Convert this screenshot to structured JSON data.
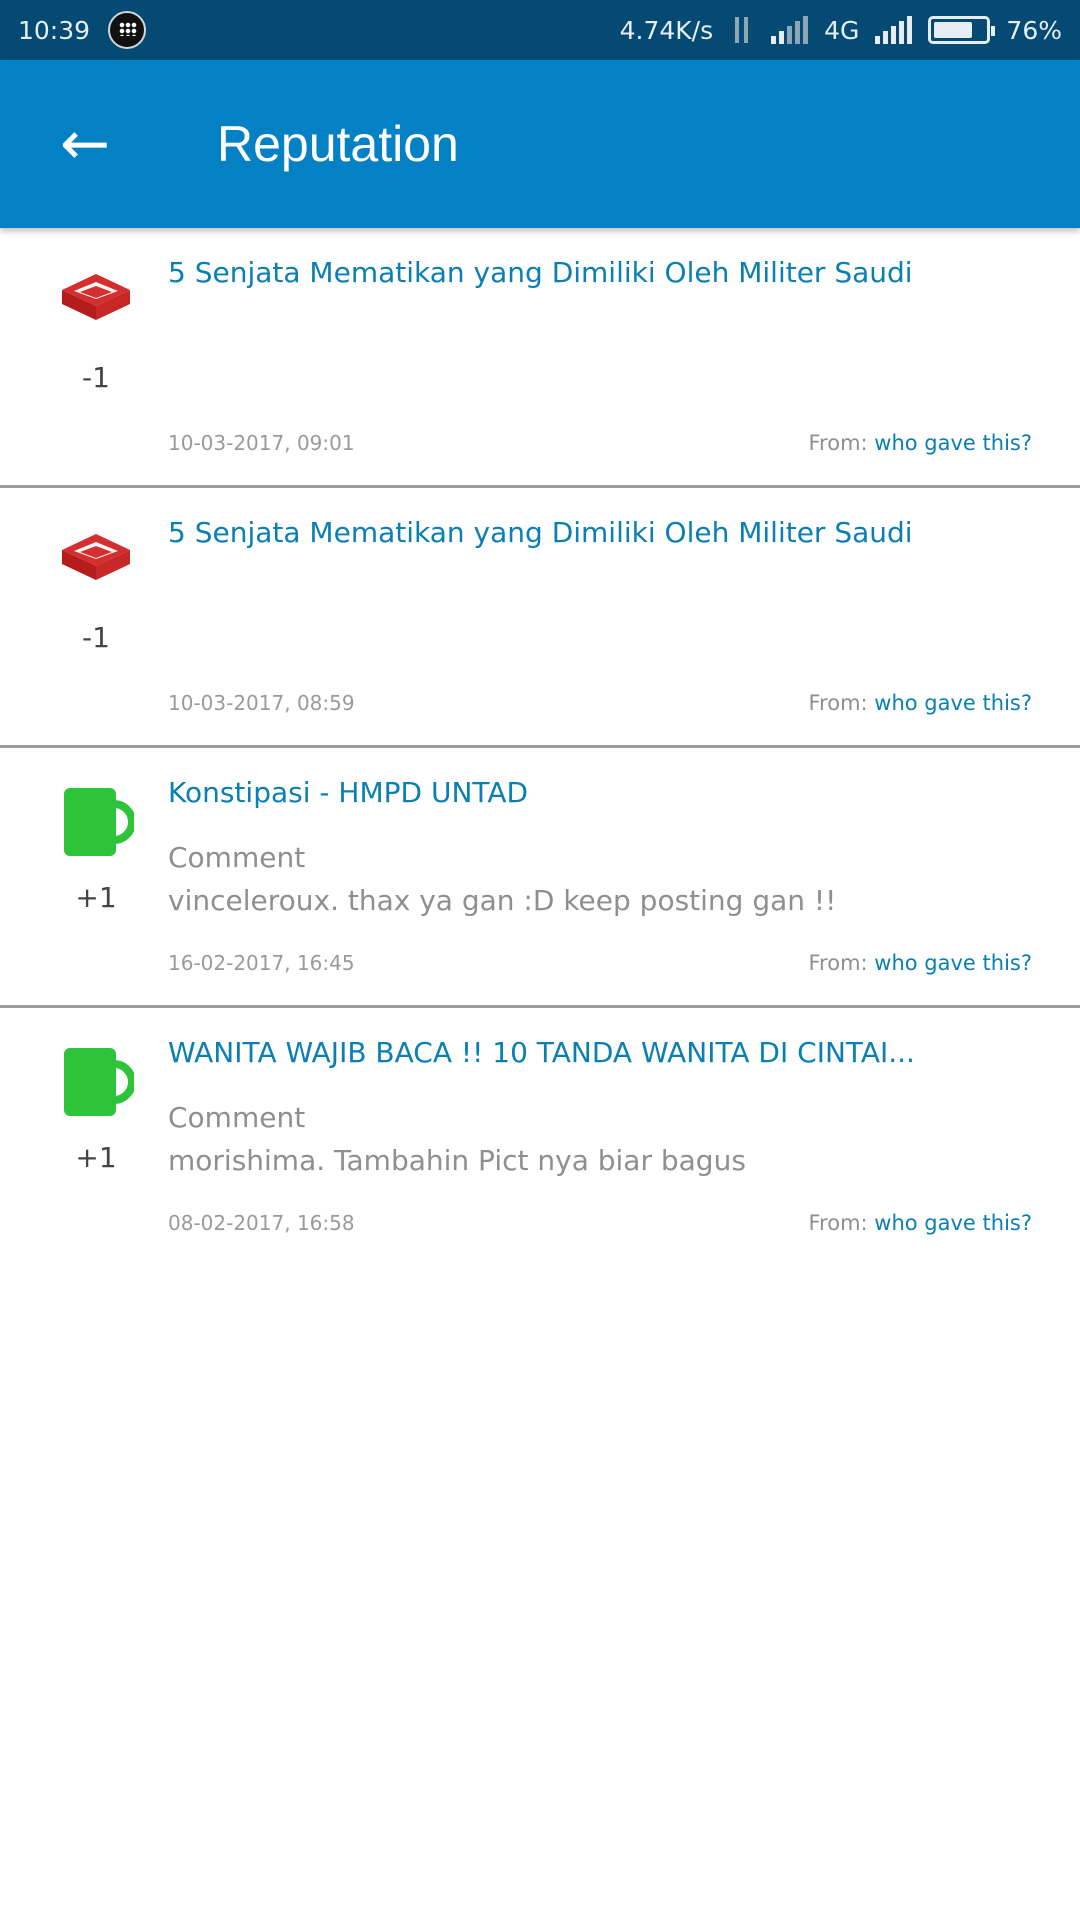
{
  "status_bar": {
    "time": "10:39",
    "speed": "4.74K/s",
    "network": "4G",
    "battery": "76%",
    "battery_level": 0.76,
    "icons": [
      "bbm-icon",
      "data-arrows-icon",
      "signal-icon",
      "battery-icon"
    ]
  },
  "app_bar": {
    "back_icon": "←",
    "title": "Reputation",
    "color": "#0480c4"
  },
  "colors": {
    "accent": "#0a7fb3",
    "negative": "#d32f2f",
    "positive": "#2ec43a"
  },
  "items": [
    {
      "icon": "brick-icon",
      "score": "-1",
      "title": "5 Senjata Mematikan yang Dimiliki Oleh Militer Saudi",
      "comment_label": "",
      "comment": "",
      "date": "10-03-2017, 09:01",
      "from_label": "From:",
      "from_link": "who gave this?"
    },
    {
      "icon": "brick-icon",
      "score": "-1",
      "title": "5 Senjata Mematikan yang Dimiliki Oleh Militer Saudi",
      "comment_label": "",
      "comment": "",
      "date": "10-03-2017, 08:59",
      "from_label": "From:",
      "from_link": "who gave this?"
    },
    {
      "icon": "cup-icon",
      "score": "+1",
      "title": "Konstipasi - HMPD UNTAD",
      "comment_label": "Comment",
      "comment": "vinceleroux. thax ya gan :D keep posting gan !!",
      "date": "16-02-2017, 16:45",
      "from_label": "From:",
      "from_link": "who gave this?"
    },
    {
      "icon": "cup-icon",
      "score": "+1",
      "title": "WANITA WAJIB BACA !! 10 TANDA WANITA DI CINTAI...",
      "comment_label": "Comment",
      "comment": "morishima. Tambahin Pict nya biar bagus",
      "date": "08-02-2017, 16:58",
      "from_label": "From:",
      "from_link": "who gave this?"
    }
  ]
}
